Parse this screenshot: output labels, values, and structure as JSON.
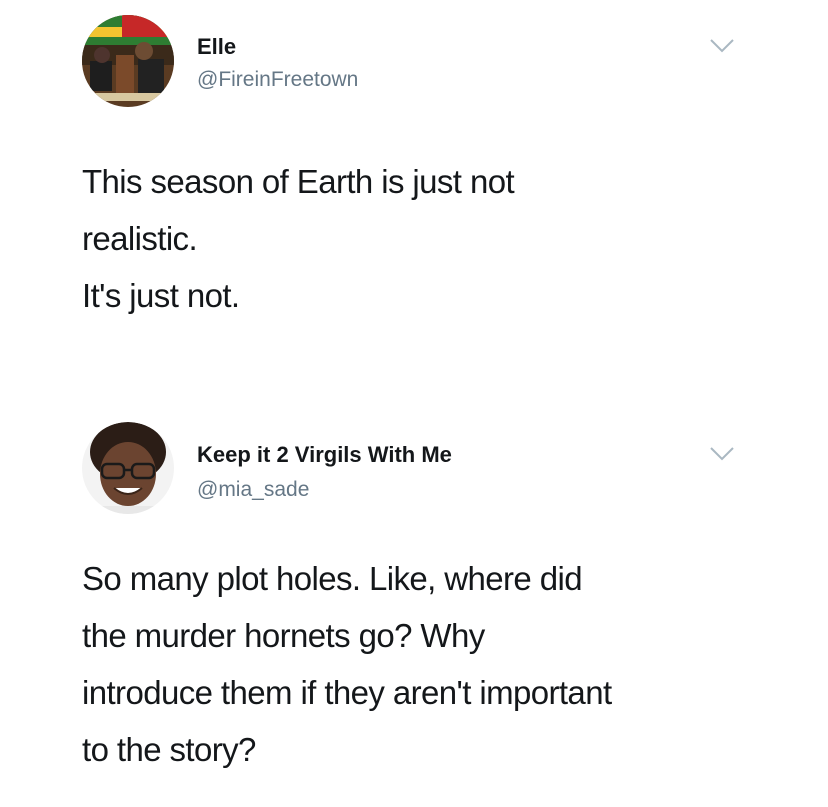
{
  "tweets": [
    {
      "display_name": "Elle",
      "handle": "@FireinFreetown",
      "menu_icon": "chevron-down-icon",
      "lines": [
        "This season of Earth is just not",
        "realistic.",
        "It's just not."
      ]
    },
    {
      "display_name": "Keep it 2 Virgils With Me",
      "handle": "@mia_sade",
      "menu_icon": "chevron-down-icon",
      "lines": [
        "So many plot holes. Like, where did",
        "the murder hornets go? Why",
        "introduce them if they aren't important",
        "to the story?"
      ]
    }
  ],
  "colors": {
    "text": "#14171a",
    "handle": "#657786",
    "chevron": "#aab8c2"
  }
}
